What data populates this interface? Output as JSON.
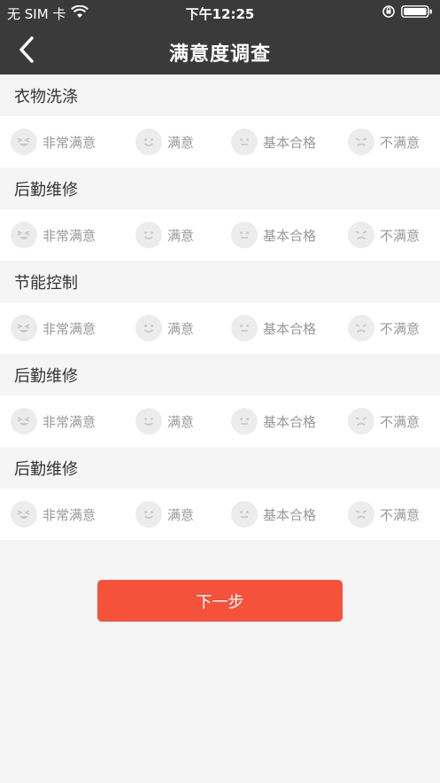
{
  "status_bar": {
    "carrier": "无 SIM 卡",
    "time": "下午12:25"
  },
  "nav": {
    "title": "满意度调查",
    "back_icon": "chevron-left-icon"
  },
  "options": [
    {
      "label": "非常满意",
      "icon": "very-satisfied-face-icon"
    },
    {
      "label": "满意",
      "icon": "smile-face-icon"
    },
    {
      "label": "基本合格",
      "icon": "neutral-face-icon"
    },
    {
      "label": "不满意",
      "icon": "unhappy-face-icon"
    }
  ],
  "sections": [
    {
      "title": "衣物洗涤"
    },
    {
      "title": "后勤维修"
    },
    {
      "title": "节能控制"
    },
    {
      "title": "后勤维修"
    },
    {
      "title": "后勤维修"
    }
  ],
  "next_button": {
    "label": "下一步"
  },
  "colors": {
    "header_bg": "#3a3a3a",
    "accent": "#f4523a",
    "page_bg": "#f5f5f5",
    "muted_text": "#999999"
  }
}
